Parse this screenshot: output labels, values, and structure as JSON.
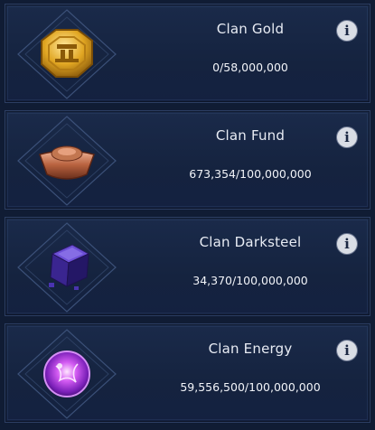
{
  "resources": [
    {
      "title": "Clan Gold",
      "value": "0/58,000,000",
      "icon": "gold-coin-icon",
      "info_glyph": "i"
    },
    {
      "title": "Clan Fund",
      "value": "673,354/100,000,000",
      "icon": "copper-ingot-icon",
      "info_glyph": "i"
    },
    {
      "title": "Clan Darksteel",
      "value": "34,370/100,000,000",
      "icon": "darksteel-cube-icon",
      "info_glyph": "i"
    },
    {
      "title": "Clan Energy",
      "value": "59,556,500/100,000,000",
      "icon": "energy-orb-icon",
      "info_glyph": "i"
    }
  ],
  "colors": {
    "background": "#101c34",
    "panel": "#1a2a4a",
    "text": "#e8ecf4"
  }
}
